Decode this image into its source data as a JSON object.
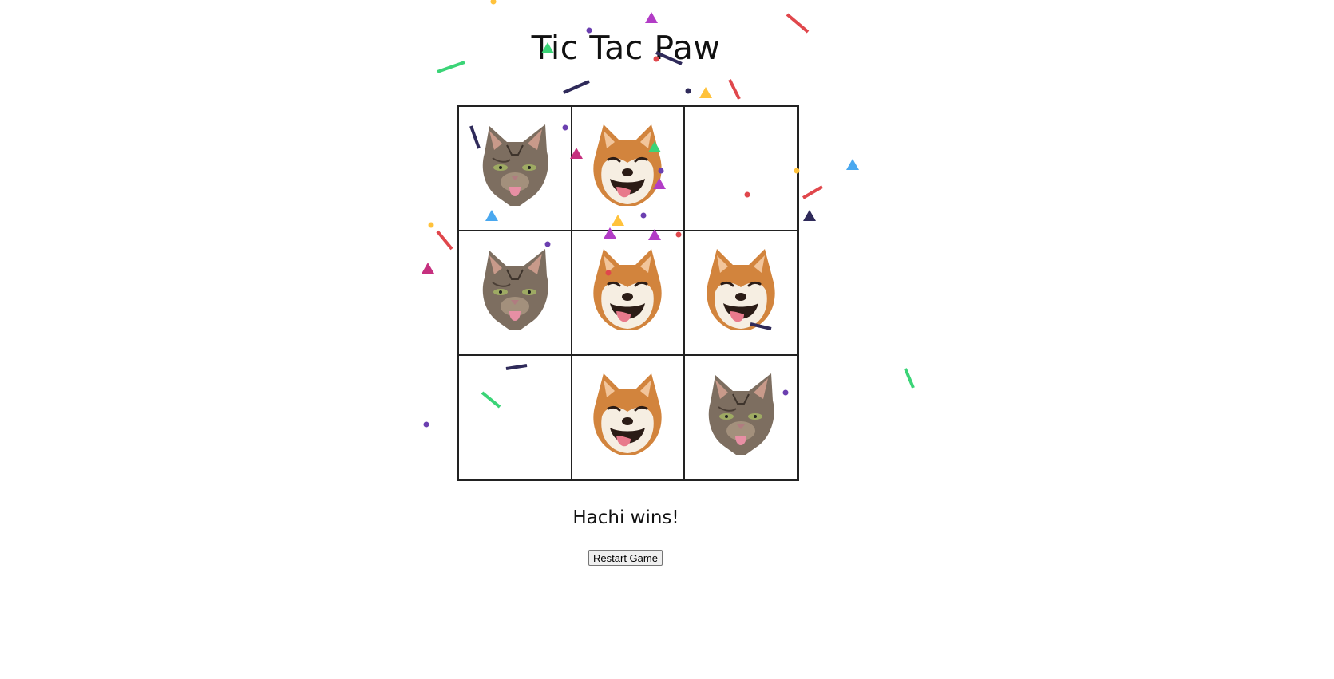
{
  "game": {
    "title": "Tic Tac Paw",
    "status": "Hachi wins!",
    "restart_label": "Restart Game",
    "board": [
      [
        "cat",
        "dog",
        ""
      ],
      [
        "cat",
        "dog",
        "dog"
      ],
      [
        "",
        "dog",
        "cat"
      ]
    ]
  },
  "pieces": {
    "cat": {
      "icon": "cat-face-icon",
      "colors": [
        "#7d6e60",
        "#a3907c",
        "#e78fa4"
      ]
    },
    "dog": {
      "icon": "shiba-face-icon",
      "colors": [
        "#d2843d",
        "#f6eee2",
        "#2b1c16"
      ]
    }
  },
  "confetti_colors": [
    "#e0474c",
    "#2f2a5a",
    "#3bd477",
    "#b23cc6",
    "#ffc23b",
    "#4aa8ef",
    "#c6307f",
    "#6b3fb0"
  ]
}
